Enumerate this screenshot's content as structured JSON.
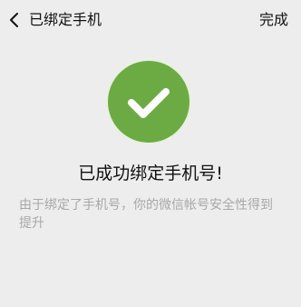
{
  "nav": {
    "back_icon": "chevron-left-icon",
    "title": "已绑定手机",
    "done_label": "完成"
  },
  "result": {
    "icon": "checkmark-circle-icon",
    "icon_color": "#6cab44",
    "title": "已成功绑定手机号!",
    "description": "由于绑定了手机号，你的微信帐号安全性得到提升"
  },
  "colors": {
    "background": "#ededed",
    "title_text": "#111111",
    "description_text": "#a8a8a8"
  }
}
